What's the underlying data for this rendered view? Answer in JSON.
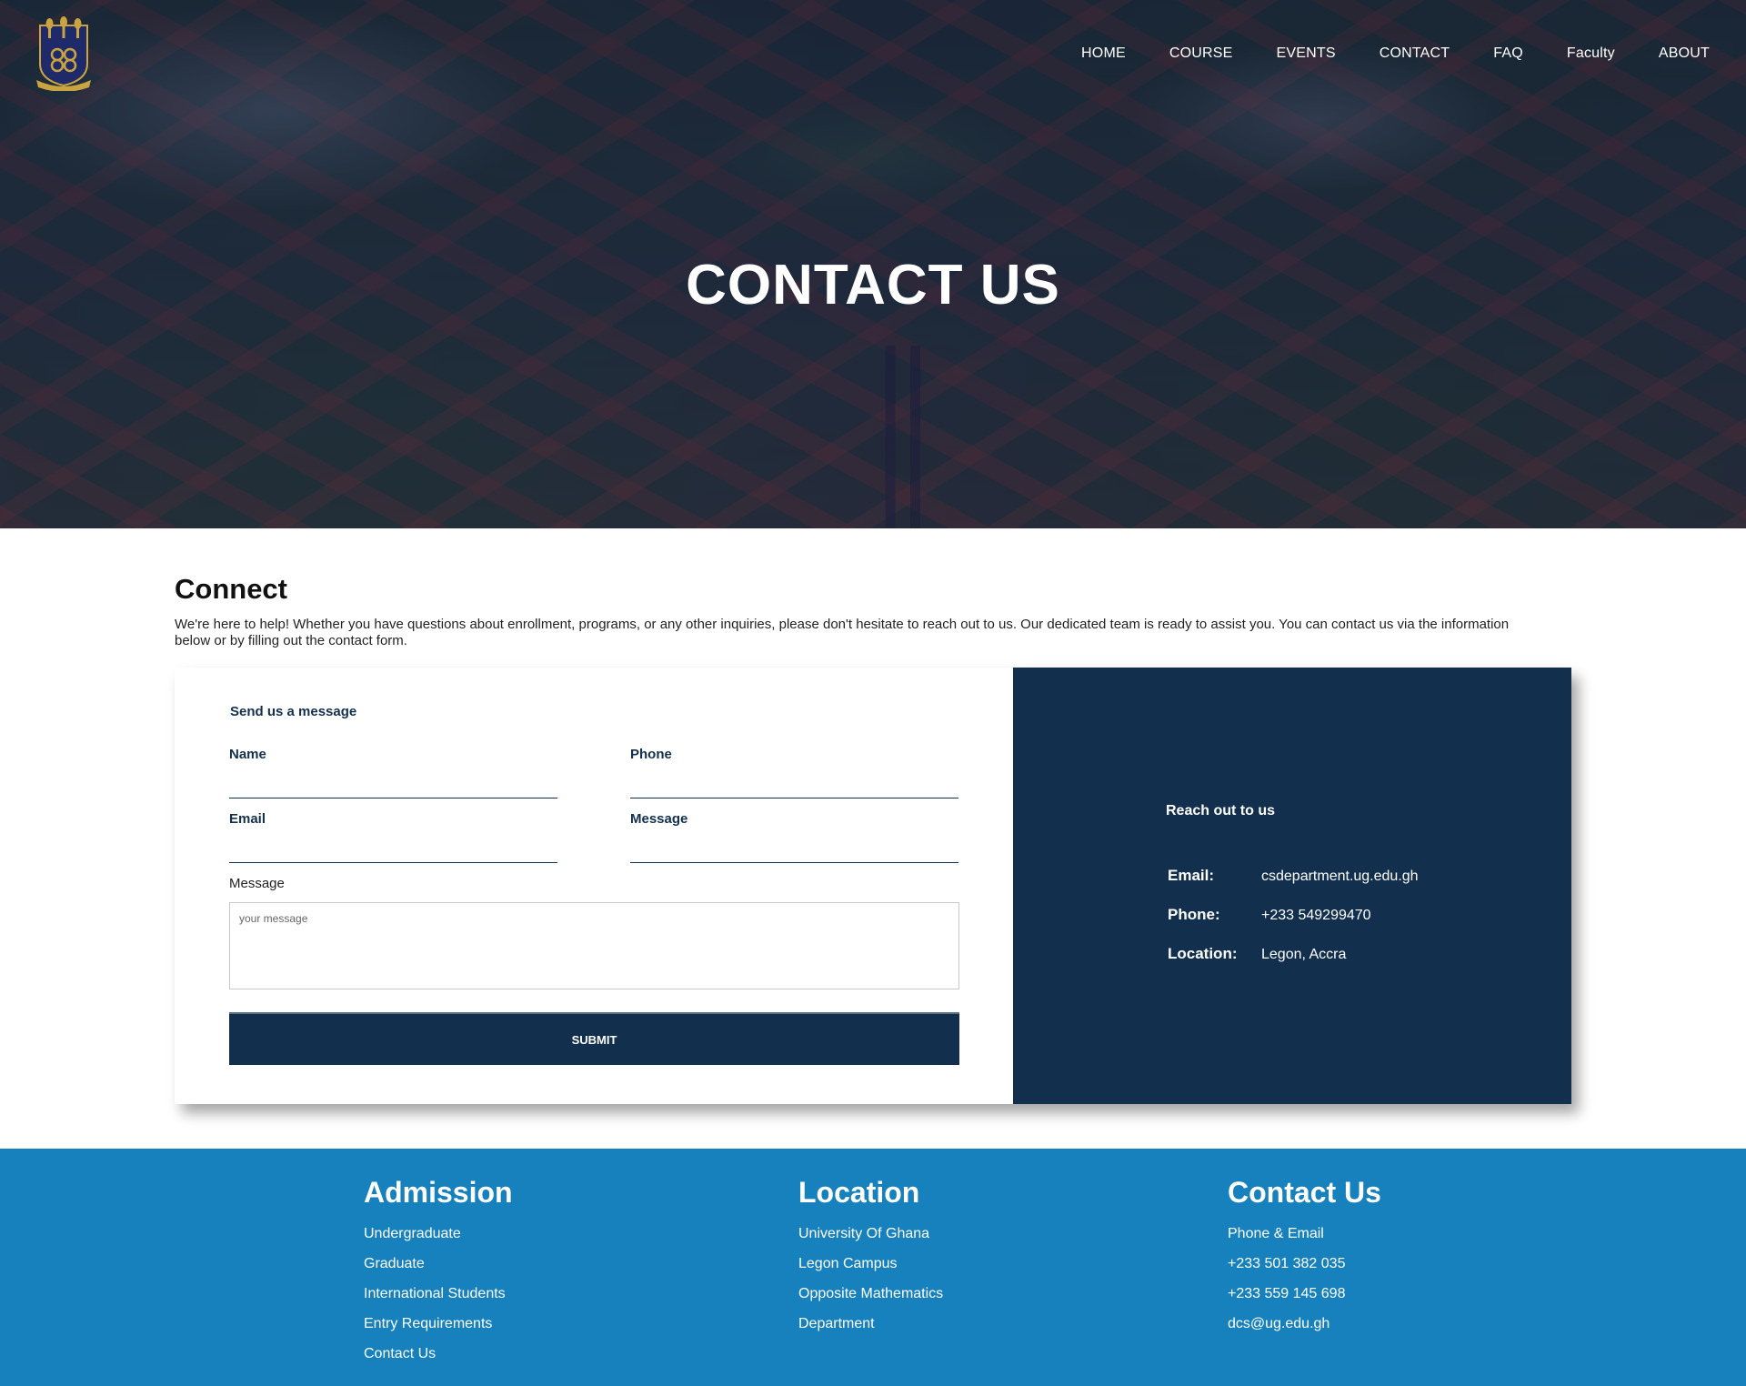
{
  "nav": {
    "logo_icon": "university-crest-icon",
    "items": [
      "HOME",
      "COURSE",
      "EVENTS",
      "CONTACT",
      "FAQ",
      "Faculty",
      "ABOUT"
    ]
  },
  "hero": {
    "title": "CONTACT US"
  },
  "connect": {
    "heading": "Connect",
    "description": "We're here to help! Whether you have questions about enrollment, programs, or any other inquiries, please don't hesitate to reach out to us. Our dedicated team is ready to assist you. You can contact us via the information below or by filling out the contact form."
  },
  "form": {
    "title": "Send us a message",
    "name_label": "Name",
    "phone_label": "Phone",
    "email_label": "Email",
    "message_label_2": "Message",
    "message_label": "Message",
    "message_placeholder": "your message",
    "submit_label": "SUBMIT"
  },
  "reach": {
    "title": "Reach out to us",
    "email_key": "Email:",
    "email_value": "csdepartment.ug.edu.gh",
    "phone_key": "Phone:",
    "phone_value": "+233 549299470",
    "location_key": "Location:",
    "location_value": "Legon, Accra"
  },
  "footer": {
    "admission": {
      "heading": "Admission",
      "links": [
        "Undergraduate",
        "Graduate",
        "International Students",
        "Entry Requirements",
        "Contact Us"
      ]
    },
    "location": {
      "heading": "Location",
      "links": [
        "University Of Ghana",
        "Legon Campus",
        "Opposite Mathematics",
        "Department"
      ]
    },
    "contact": {
      "heading": "Contact Us",
      "links": [
        "Phone & Email",
        "+233 501 382 035",
        "+233 559 145 698",
        "dcs@ug.edu.gh"
      ]
    }
  },
  "colors": {
    "navy": "#12304d",
    "footer_blue": "#1681bd",
    "hero_overlay": "#0f1246"
  }
}
